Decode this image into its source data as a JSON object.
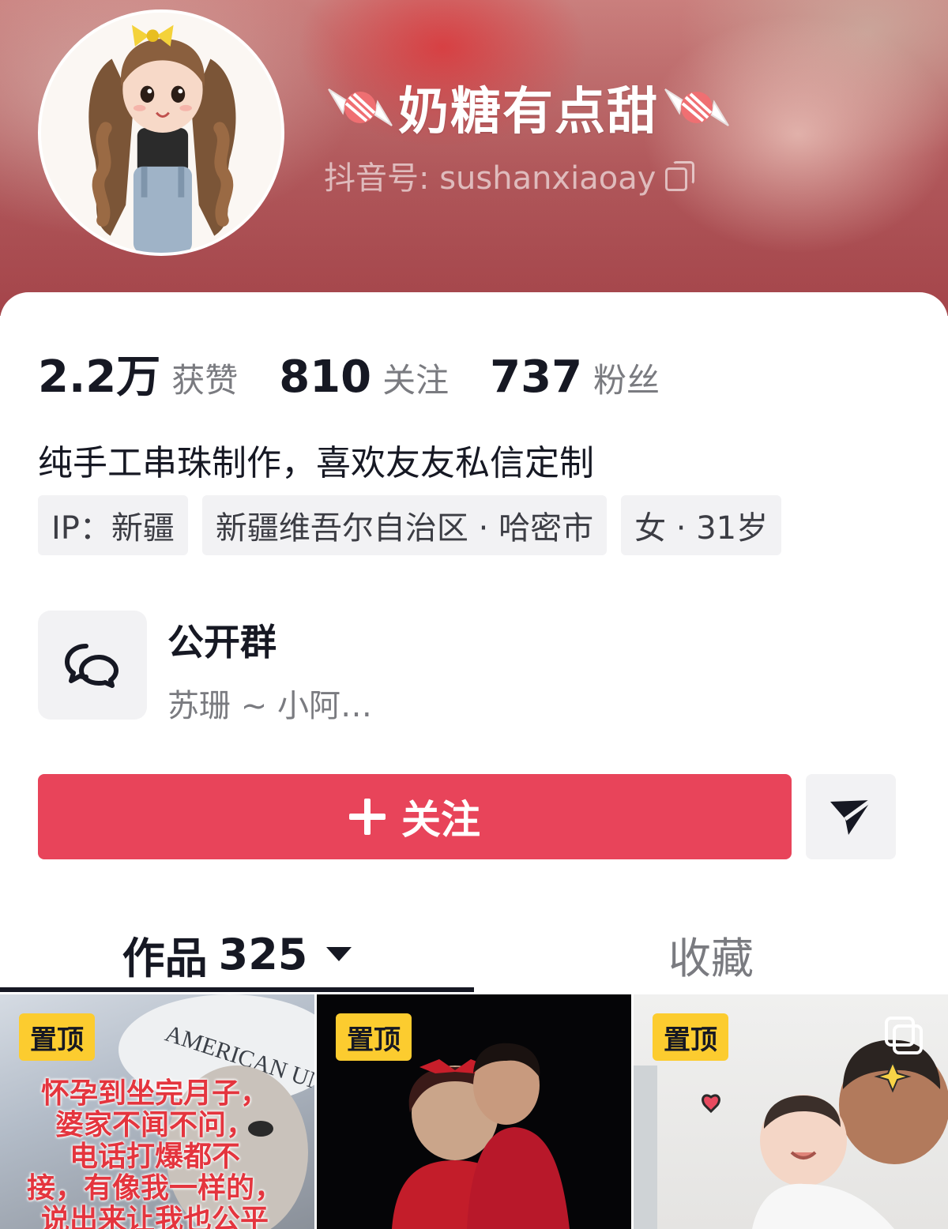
{
  "profile": {
    "nickname": "奶糖有点甜",
    "douyin_id": "抖音号: sushanxiaoay"
  },
  "stats": [
    {
      "value": "2.2万",
      "label": "获赞"
    },
    {
      "value": "810",
      "label": "关注"
    },
    {
      "value": "737",
      "label": "粉丝"
    }
  ],
  "bio": "纯手工串珠制作，喜欢友友私信定制",
  "tags": [
    "IP：新疆",
    "新疆维吾尔自治区 · 哈密市",
    "女 · 31岁"
  ],
  "group": {
    "title": "公开群",
    "subtitle": "苏珊 ~ 小阿…"
  },
  "actions": {
    "follow_label": "关注"
  },
  "tabs": {
    "works_label": "作品",
    "works_count": "325",
    "favorites_label": "收藏"
  },
  "videos": [
    {
      "badge": "置顶",
      "overlay_text": "怀孕到坐完月子，\n婆家不闻不问，\n电话打爆都不\n接，有像我一样的，\n说出来让我也公平",
      "cap_text": "AMERICAN UNIVERSITY"
    },
    {
      "badge": "置顶"
    },
    {
      "badge": "置顶"
    }
  ],
  "colors": {
    "accent": "#e8445a",
    "pin_badge": "#fccc2f",
    "text_primary": "#161823",
    "text_secondary": "#7a7b80"
  }
}
